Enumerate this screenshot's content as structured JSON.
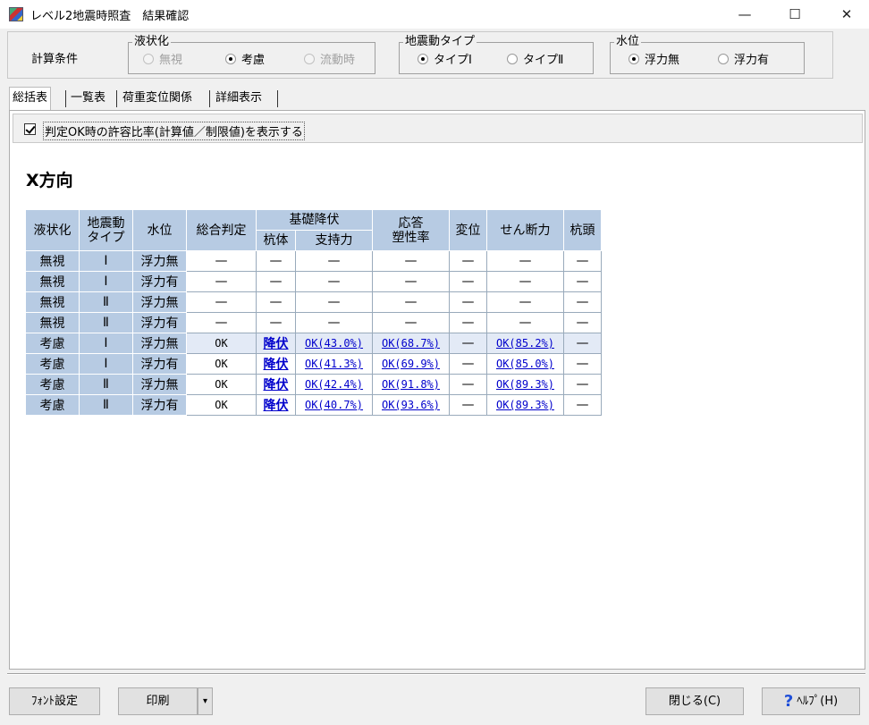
{
  "window": {
    "title": "レベル2地震時照査　結果確認",
    "controls": {
      "minimize": "—",
      "maximize": "☐",
      "close": "✕"
    }
  },
  "calc_conditions": {
    "label": "計算条件",
    "liquefaction": {
      "title": "液状化",
      "options": [
        "無視",
        "考慮",
        "流動時"
      ],
      "selected": "考慮",
      "disabled": [
        "無視",
        "流動時"
      ]
    },
    "motion_type": {
      "title": "地震動タイプ",
      "options": [
        "タイプⅠ",
        "タイプⅡ"
      ],
      "selected": "タイプⅠ"
    },
    "water_level": {
      "title": "水位",
      "options": [
        "浮力無",
        "浮力有"
      ],
      "selected": "浮力無"
    }
  },
  "tabs": [
    {
      "label": "総括表",
      "active": true
    },
    {
      "label": "一覧表",
      "active": false
    },
    {
      "label": "荷重変位関係",
      "active": false
    },
    {
      "label": "詳細表示",
      "active": false
    }
  ],
  "options": {
    "show_ratio_label": "判定OK時の許容比率(計算値／制限値)を表示する",
    "show_ratio_checked": true
  },
  "direction_title": "X方向",
  "table": {
    "headers": {
      "liquefaction": "液状化",
      "motion_type_1": "地震動",
      "motion_type_2": "タイプ",
      "water": "水位",
      "overall": "総合判定",
      "foundation_yield": "基礎降伏",
      "pile_body": "杭体",
      "bearing": "支持力",
      "ductility_1": "応答",
      "ductility_2": "塑性率",
      "displacement": "変位",
      "shear": "せん断力",
      "pile_head": "杭頭"
    },
    "rows": [
      {
        "liq": "無視",
        "type": "Ⅰ",
        "water": "浮力無",
        "overall": "—",
        "pile": "—",
        "bearing": "—",
        "ductility": "—",
        "disp": "—",
        "shear": "—",
        "head": "—"
      },
      {
        "liq": "無視",
        "type": "Ⅰ",
        "water": "浮力有",
        "overall": "—",
        "pile": "—",
        "bearing": "—",
        "ductility": "—",
        "disp": "—",
        "shear": "—",
        "head": "—"
      },
      {
        "liq": "無視",
        "type": "Ⅱ",
        "water": "浮力無",
        "overall": "—",
        "pile": "—",
        "bearing": "—",
        "ductility": "—",
        "disp": "—",
        "shear": "—",
        "head": "—"
      },
      {
        "liq": "無視",
        "type": "Ⅱ",
        "water": "浮力有",
        "overall": "—",
        "pile": "—",
        "bearing": "—",
        "ductility": "—",
        "disp": "—",
        "shear": "—",
        "head": "—"
      },
      {
        "liq": "考慮",
        "type": "Ⅰ",
        "water": "浮力無",
        "overall": "OK",
        "pile": "降伏",
        "bearing": "OK(43.0%)",
        "ductility": "OK(68.7%)",
        "disp": "—",
        "shear": "OK(85.2%)",
        "head": "—"
      },
      {
        "liq": "考慮",
        "type": "Ⅰ",
        "water": "浮力有",
        "overall": "OK",
        "pile": "降伏",
        "bearing": "OK(41.3%)",
        "ductility": "OK(69.9%)",
        "disp": "—",
        "shear": "OK(85.0%)",
        "head": "—"
      },
      {
        "liq": "考慮",
        "type": "Ⅱ",
        "water": "浮力無",
        "overall": "OK",
        "pile": "降伏",
        "bearing": "OK(42.4%)",
        "ductility": "OK(91.8%)",
        "disp": "—",
        "shear": "OK(89.3%)",
        "head": "—"
      },
      {
        "liq": "考慮",
        "type": "Ⅱ",
        "water": "浮力有",
        "overall": "OK",
        "pile": "降伏",
        "bearing": "OK(40.7%)",
        "ductility": "OK(93.6%)",
        "disp": "—",
        "shear": "OK(89.3%)",
        "head": "—"
      }
    ]
  },
  "buttons": {
    "font_settings": "ﾌｫﾝﾄ設定",
    "print": "印刷",
    "print_dropdown": "▾",
    "close": "閉じる(C)",
    "help": "ﾍﾙﾌﾟ(H)",
    "help_glyph": "?"
  }
}
